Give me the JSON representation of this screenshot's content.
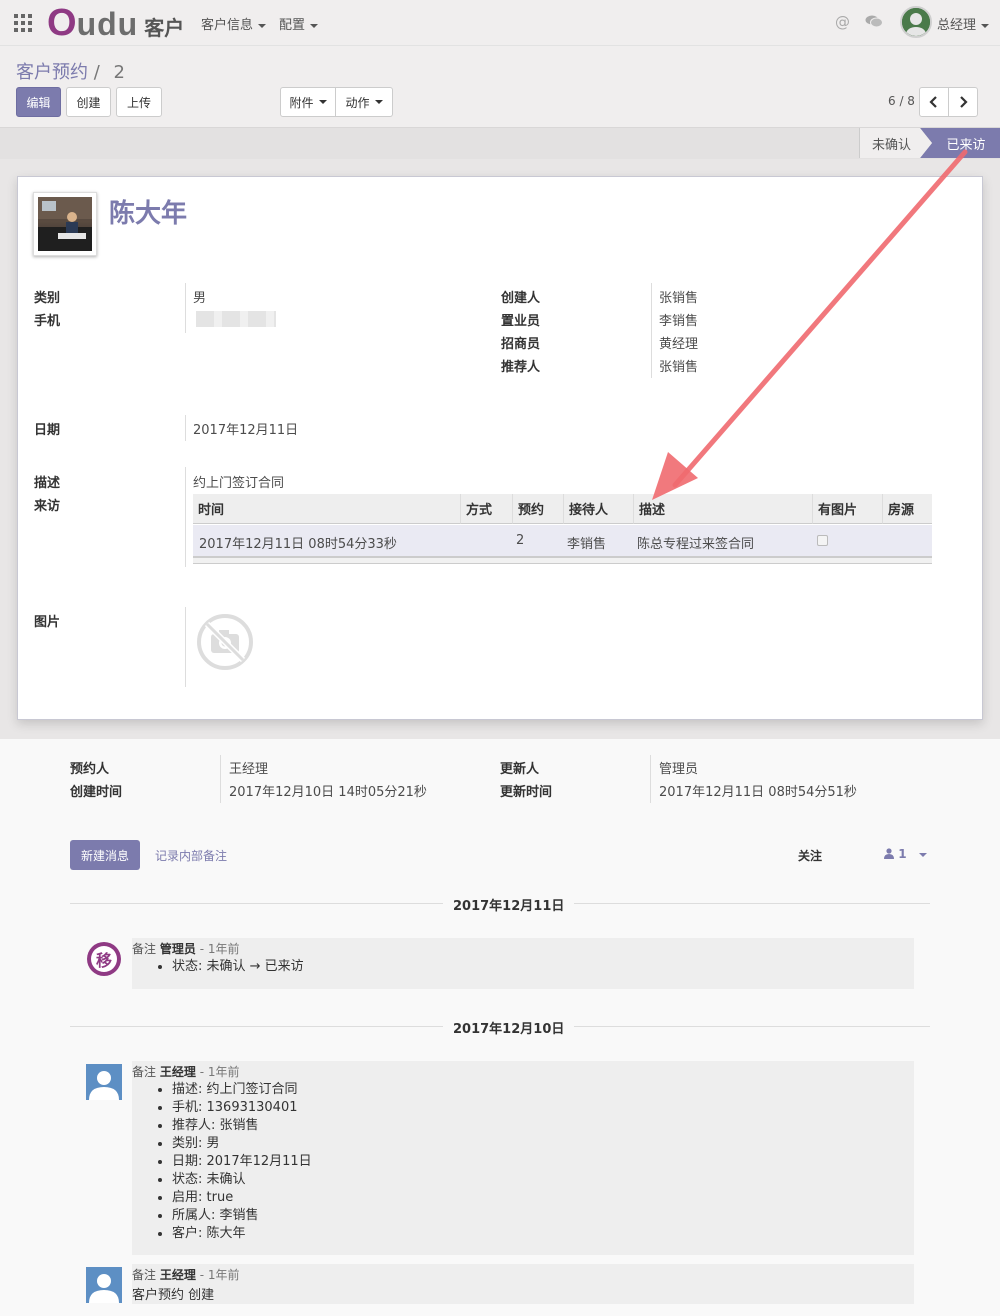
{
  "topbar": {
    "logo_o": "O",
    "logo_udu": "udu",
    "app_name": "客户",
    "menus": [
      "客户信息",
      "配置"
    ],
    "at_symbol": "@",
    "user": "总经理"
  },
  "breadcrumb": {
    "parent": "客户预约",
    "separator": "/",
    "current": "2"
  },
  "buttons": {
    "edit": "编辑",
    "create": "创建",
    "upload": "上传",
    "attachment": "附件",
    "action": "动作"
  },
  "pager": {
    "value": "6 / 8"
  },
  "statusbar": {
    "unconfirmed": "未确认",
    "visited": "已来访",
    "active": "已来访"
  },
  "record": {
    "name": "陈大年",
    "fields_left": [
      {
        "label": "类别",
        "value": "男",
        "link": true
      },
      {
        "label": "手机",
        "value": "",
        "blurred": true
      }
    ],
    "fields_right": [
      {
        "label": "创建人",
        "value": "张销售"
      },
      {
        "label": "置业员",
        "value": "李销售"
      },
      {
        "label": "招商员",
        "value": "黄经理"
      },
      {
        "label": "推荐人",
        "value": "张销售"
      }
    ],
    "date_label": "日期",
    "date_value": "2017年12月11日",
    "desc_label": "描述",
    "desc_value": "约上门签订合同",
    "visit_label": "来访",
    "image_label": "图片"
  },
  "visit_table": {
    "columns": [
      "时间",
      "方式",
      "预约",
      "接待人",
      "描述",
      "有图片",
      "房源"
    ],
    "rows": [
      {
        "time": "2017年12月11日 08时54分33秒",
        "method": "",
        "appointment": "2",
        "receptionist": "李销售",
        "description": "陈总专程过来签合同",
        "has_image": false,
        "house": ""
      }
    ]
  },
  "footer_info": {
    "left": [
      {
        "label": "预约人",
        "value": "王经理",
        "link": true
      },
      {
        "label": "创建时间",
        "value": "2017年12月10日 14时05分21秒"
      }
    ],
    "right": [
      {
        "label": "更新人",
        "value": "管理员",
        "link": true
      },
      {
        "label": "更新时间",
        "value": "2017年12月11日 08时54分51秒"
      }
    ]
  },
  "chatter": {
    "new_message": "新建消息",
    "log_note": "记录内部备注",
    "follow": "关注",
    "followers_count": "1",
    "groups": [
      {
        "date": "2017年12月11日",
        "messages": [
          {
            "type": "备注",
            "author": "管理员",
            "ago": "- 1年前",
            "avatar": "yi-logo",
            "avatar_char": "移",
            "items": [
              "状态: 未确认 → 已来访"
            ]
          }
        ]
      },
      {
        "date": "2017年12月10日",
        "messages": [
          {
            "type": "备注",
            "author": "王经理",
            "ago": "- 1年前",
            "avatar": "person",
            "items": [
              "描述: 约上门签订合同",
              "手机: 13693130401",
              "推荐人: 张销售",
              "类别: 男",
              "日期: 2017年12月11日",
              "状态: 未确认",
              "启用: true",
              "所属人: 李销售",
              "客户: 陈大年"
            ]
          },
          {
            "type": "备注",
            "author": "王经理",
            "ago": "- 1年前",
            "avatar": "person",
            "body": "客户预约 创建"
          }
        ]
      }
    ]
  },
  "colors": {
    "brand": "#7c7bad",
    "logo": "#8f3a84",
    "annotation_arrow": "#f06a6f"
  }
}
